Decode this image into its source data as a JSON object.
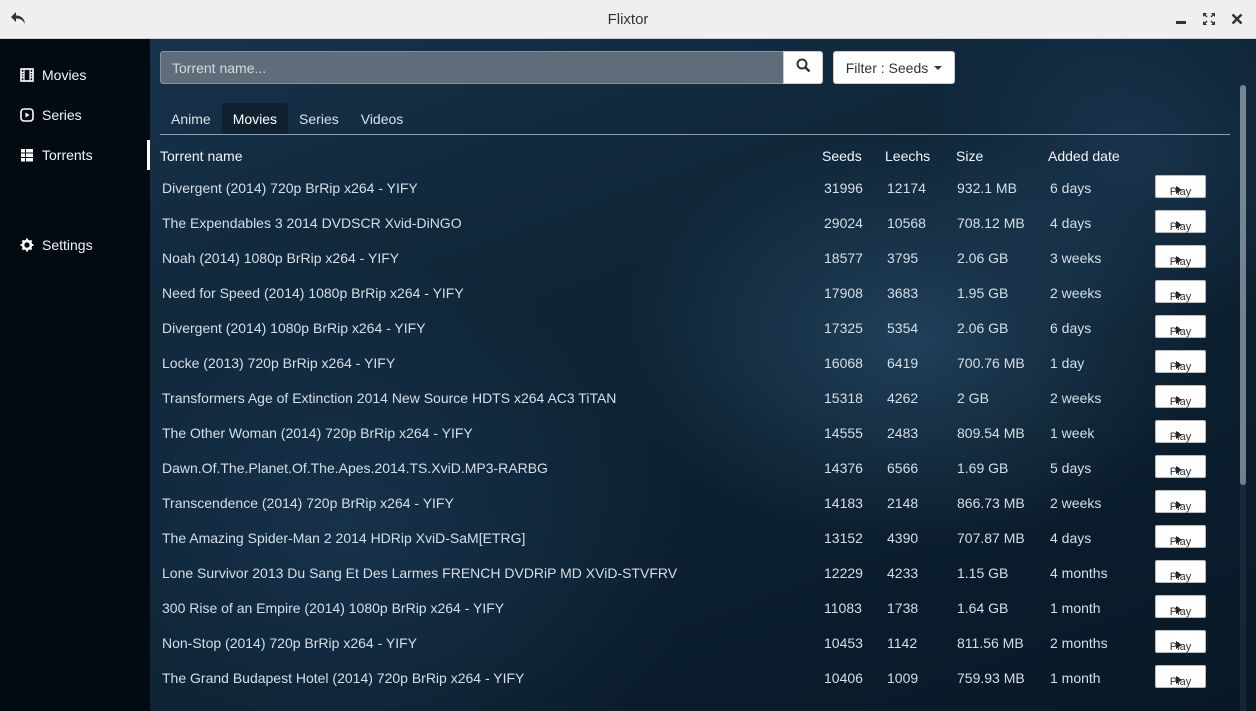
{
  "window": {
    "title": "Flixtor",
    "back_icon": "back-arrow-icon",
    "minimize_icon": "minimize-icon",
    "maximize_icon": "maximize-icon",
    "close_icon": "close-icon"
  },
  "sidebar": {
    "items": [
      {
        "label": "Movies",
        "icon": "film-icon"
      },
      {
        "label": "Series",
        "icon": "play-circle-icon"
      },
      {
        "label": "Torrents",
        "icon": "grid-list-icon",
        "active": true
      },
      {
        "label": "Settings",
        "icon": "gear-icon"
      }
    ]
  },
  "search": {
    "placeholder": "Torrent name...",
    "value": "",
    "button_icon": "search-icon",
    "filter_label": "Filter : Seeds"
  },
  "tabs": [
    {
      "label": "Anime"
    },
    {
      "label": "Movies",
      "active": true
    },
    {
      "label": "Series"
    },
    {
      "label": "Videos"
    }
  ],
  "table": {
    "headers": {
      "name": "Torrent name",
      "seeds": "Seeds",
      "leechs": "Leechs",
      "size": "Size",
      "date": "Added date"
    },
    "play_label": "Play",
    "rows": [
      {
        "name": "Divergent (2014) 720p BrRip x264 - YIFY",
        "seeds": "31996",
        "leechs": "12174",
        "size": "932.1 MB",
        "date": "6 days"
      },
      {
        "name": "The Expendables 3 2014 DVDSCR Xvid-DiNGO",
        "seeds": "29024",
        "leechs": "10568",
        "size": "708.12 MB",
        "date": "4 days"
      },
      {
        "name": "Noah (2014) 1080p BrRip x264 - YIFY",
        "seeds": "18577",
        "leechs": "3795",
        "size": "2.06 GB",
        "date": "3 weeks"
      },
      {
        "name": "Need for Speed (2014) 1080p BrRip x264 - YIFY",
        "seeds": "17908",
        "leechs": "3683",
        "size": "1.95 GB",
        "date": "2 weeks"
      },
      {
        "name": "Divergent (2014) 1080p BrRip x264 - YIFY",
        "seeds": "17325",
        "leechs": "5354",
        "size": "2.06 GB",
        "date": "6 days"
      },
      {
        "name": "Locke (2013) 720p BrRip x264 - YIFY",
        "seeds": "16068",
        "leechs": "6419",
        "size": "700.76 MB",
        "date": "1 day"
      },
      {
        "name": "Transformers Age of Extinction 2014 New Source HDTS x264 AC3 TiTAN",
        "seeds": "15318",
        "leechs": "4262",
        "size": "2 GB",
        "date": "2 weeks"
      },
      {
        "name": "The Other Woman (2014) 720p BrRip x264 - YIFY",
        "seeds": "14555",
        "leechs": "2483",
        "size": "809.54 MB",
        "date": "1 week"
      },
      {
        "name": "Dawn.Of.The.Planet.Of.The.Apes.2014.TS.XviD.MP3-RARBG",
        "seeds": "14376",
        "leechs": "6566",
        "size": "1.69 GB",
        "date": "5 days"
      },
      {
        "name": "Transcendence (2014) 720p BrRip x264 - YIFY",
        "seeds": "14183",
        "leechs": "2148",
        "size": "866.73 MB",
        "date": "2 weeks"
      },
      {
        "name": "The Amazing Spider-Man 2 2014 HDRip XviD-SaM[ETRG]",
        "seeds": "13152",
        "leechs": "4390",
        "size": "707.87 MB",
        "date": "4 days"
      },
      {
        "name": "Lone Survivor 2013 Du Sang Et Des Larmes FRENCH DVDRiP MD XViD-STVFRV",
        "seeds": "12229",
        "leechs": "4233",
        "size": "1.15 GB",
        "date": "4 months"
      },
      {
        "name": "300 Rise of an Empire (2014) 1080p BrRip x264 - YIFY",
        "seeds": "11083",
        "leechs": "1738",
        "size": "1.64 GB",
        "date": "1 month"
      },
      {
        "name": "Non-Stop (2014) 720p BrRip x264 - YIFY",
        "seeds": "10453",
        "leechs": "1142",
        "size": "811.56 MB",
        "date": "2 months"
      },
      {
        "name": "The Grand Budapest Hotel (2014) 720p BrRip x264 - YIFY",
        "seeds": "10406",
        "leechs": "1009",
        "size": "759.93 MB",
        "date": "1 month"
      }
    ]
  },
  "colors": {
    "titlebar": "#efefef",
    "sidebar": "#020a12",
    "accent_active": "#ffffff"
  }
}
